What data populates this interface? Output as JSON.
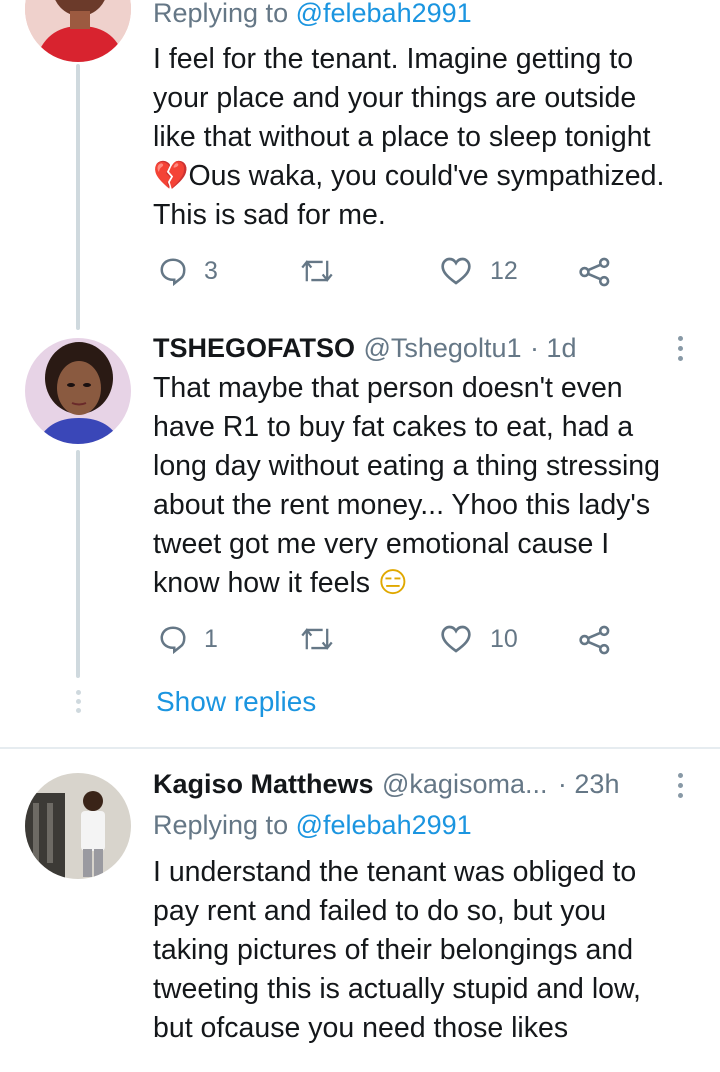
{
  "tweets": [
    {
      "replying_prefix": "Replying to ",
      "replying_handle": "@felebah2991",
      "lines": [
        "I feel for the tenant. Imagine getting to",
        "your place and your things are outside",
        "like that without a place to sleep tonight"
      ],
      "emoji": "💔",
      "line4_rest": "Ous waka, you could've sympathized.",
      "line5": "This is sad for me.",
      "replies": "3",
      "retweets": "",
      "likes": "12"
    },
    {
      "name": "TSHEGOFATSO",
      "handle": "@Tshegoltu1",
      "time": "· 1d",
      "lines": [
        "That maybe that person doesn't even",
        "have R1 to buy fat cakes to eat, had a",
        "long day without eating a thing stressing",
        "about the rent money... Yhoo this lady's",
        "tweet got me very emotional cause I"
      ],
      "line6": "know how it feels ",
      "emoji": "😑",
      "replies": "1",
      "retweets": "",
      "likes": "10",
      "show_replies": "Show replies"
    },
    {
      "name": "Kagiso Matthews",
      "handle": "@kagisoma...",
      "time": "· 23h",
      "replying_prefix": "Replying to ",
      "replying_handle": "@felebah2991",
      "lines": [
        "I understand the tenant was obliged to",
        "pay rent and failed to do so, but you",
        "taking pictures of their belongings and",
        "tweeting this is actually stupid and low,",
        "but ofcause you need those likes"
      ]
    }
  ],
  "icons": {
    "reply": "reply-icon",
    "retweet": "retweet-icon",
    "like": "heart-icon",
    "share": "share-icon",
    "more": "more-vertical-icon"
  },
  "colors": {
    "link": "#1b95e0",
    "secondary": "#657786",
    "thread_line": "#cfd9de"
  }
}
